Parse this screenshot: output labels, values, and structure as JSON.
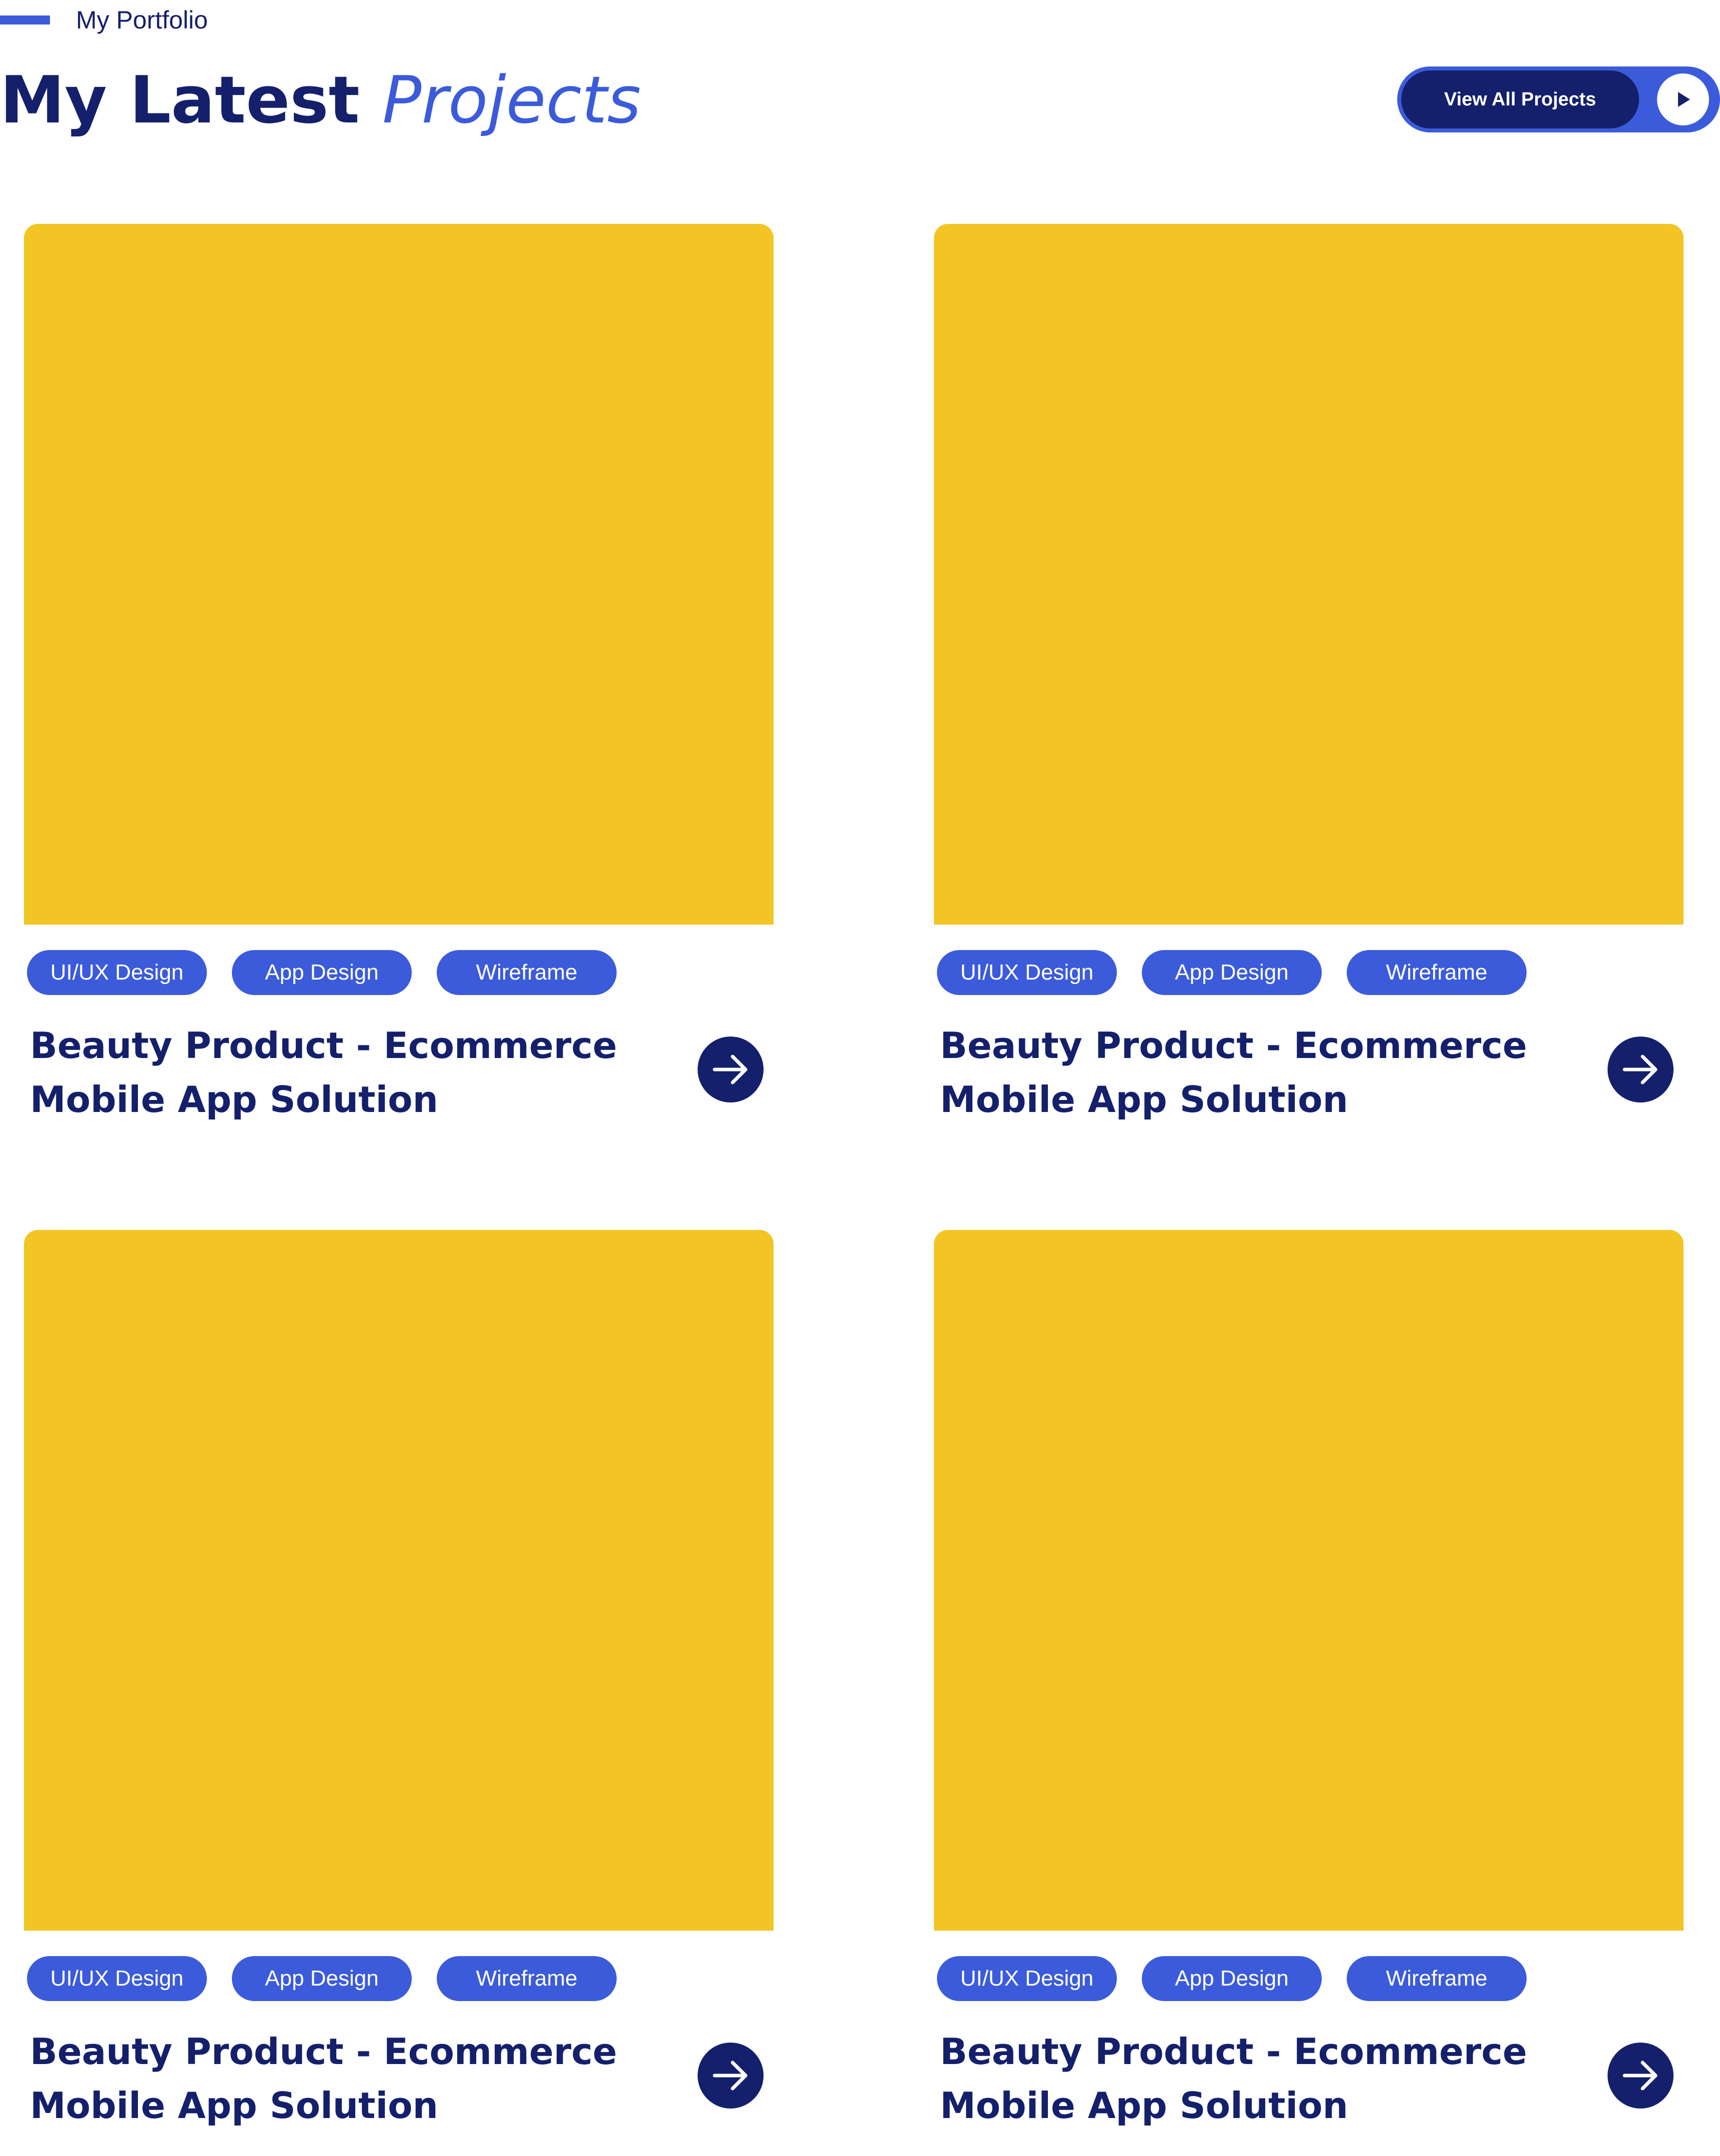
{
  "section": {
    "eyebrow": "My Portfolio",
    "title_strong": "My Latest",
    "title_accent": "Projects",
    "view_all_label": "View All Projects"
  },
  "colors": {
    "navy": "#14206b",
    "accent_blue": "#3b5bdb",
    "image_placeholder": "#f2c524"
  },
  "icons": {
    "view_all": "play-icon",
    "card_link": "arrow-right-icon"
  },
  "projects": [
    {
      "tags": [
        "UI/UX Design",
        "App Design",
        "Wireframe"
      ],
      "title": "Beauty Product - Ecommerce Mobile App Solution"
    },
    {
      "tags": [
        "UI/UX Design",
        "App Design",
        "Wireframe"
      ],
      "title": "Beauty Product - Ecommerce Mobile App Solution"
    },
    {
      "tags": [
        "UI/UX Design",
        "App Design",
        "Wireframe"
      ],
      "title": "Beauty Product - Ecommerce Mobile App Solution"
    },
    {
      "tags": [
        "UI/UX Design",
        "App Design",
        "Wireframe"
      ],
      "title": "Beauty Product - Ecommerce Mobile App Solution"
    }
  ]
}
